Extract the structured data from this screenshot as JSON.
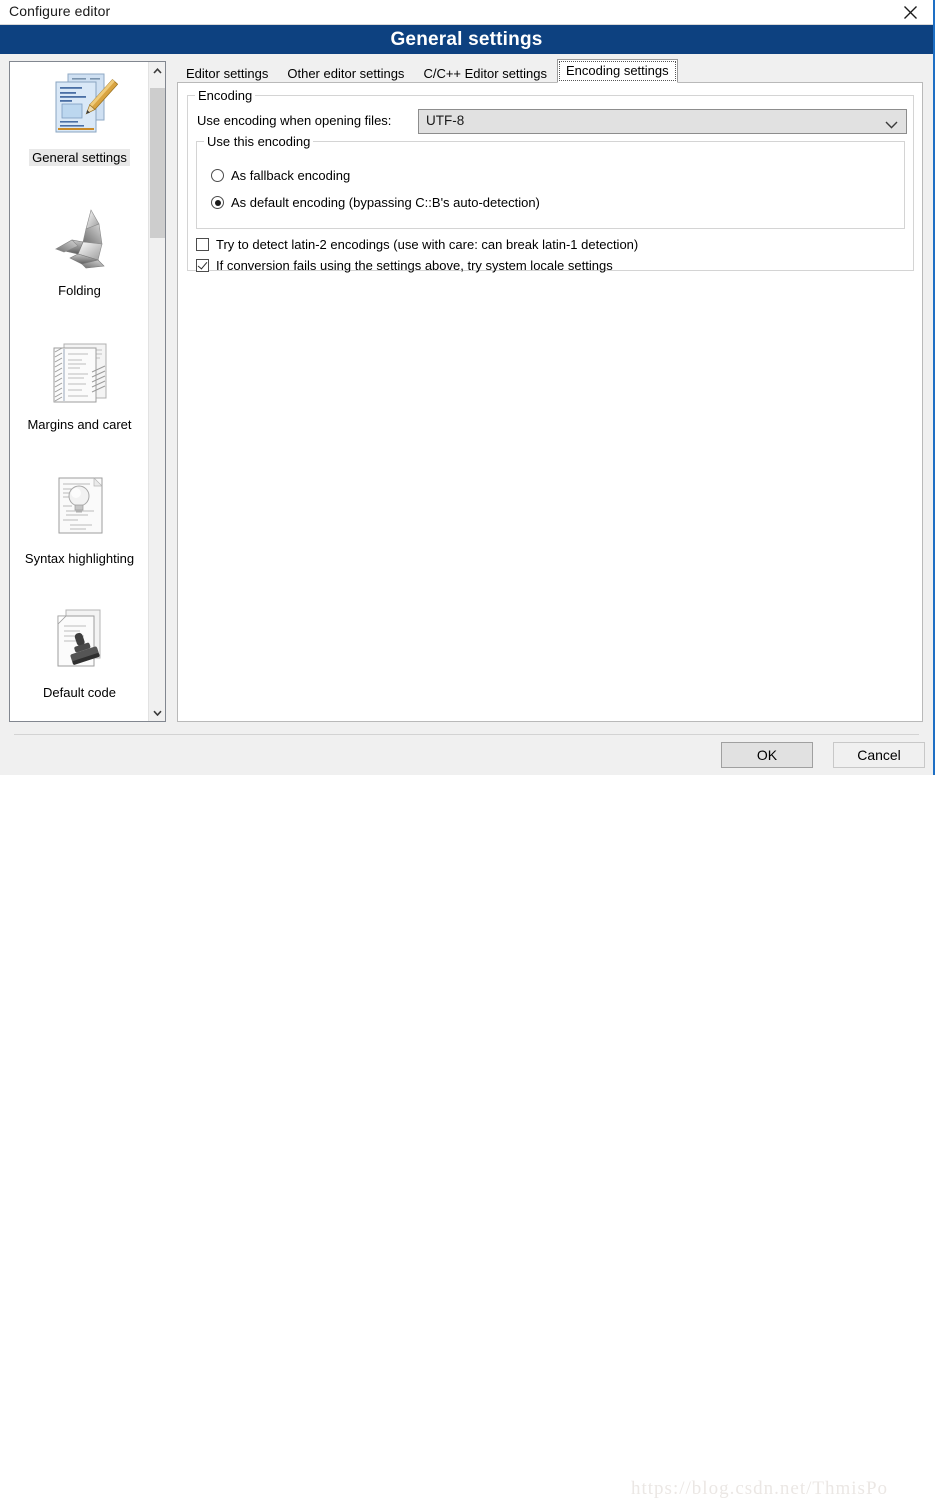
{
  "window": {
    "title": "Configure editor",
    "close_icon": "close-icon",
    "header_title": "General settings",
    "accent_blue": "#0d4180",
    "border_blue": "#1e6fc4"
  },
  "sidebar": {
    "items": [
      {
        "label": "General settings",
        "icon": "code-document-pencil-icon",
        "selected": true
      },
      {
        "label": "Folding",
        "icon": "origami-paper-crane-icon",
        "selected": false
      },
      {
        "label": "Margins and caret",
        "icon": "lined-document-stack-icon",
        "selected": false
      },
      {
        "label": "Syntax highlighting",
        "icon": "document-lightbulb-icon",
        "selected": false
      },
      {
        "label": "Default code",
        "icon": "document-rubber-stamp-icon",
        "selected": false
      }
    ],
    "scroll": {
      "up_icon": "chevron-up-icon",
      "down_icon": "chevron-down-icon"
    }
  },
  "tabs": [
    {
      "label": "Editor settings",
      "active": false
    },
    {
      "label": "Other editor settings",
      "active": false
    },
    {
      "label": "C/C++ Editor settings",
      "active": false
    },
    {
      "label": "Encoding settings",
      "active": true
    }
  ],
  "encoding_group": {
    "title": "Encoding",
    "use_encoding_label": "Use encoding when opening files:",
    "combo": {
      "value": "UTF-8",
      "arrow_icon": "chevron-down-icon"
    },
    "use_this_encoding": {
      "title": "Use this encoding",
      "options": [
        {
          "label": "As fallback encoding",
          "selected": false
        },
        {
          "label": "As default encoding (bypassing C::B's auto-detection)",
          "selected": true
        }
      ]
    },
    "checkboxes": [
      {
        "label": "Try to detect latin-2 encodings (use with care: can break latin-1 detection)",
        "checked": false
      },
      {
        "label": "If conversion fails using the settings above, try system locale settings",
        "checked": true
      }
    ]
  },
  "footer": {
    "ok_label": "OK",
    "cancel_label": "Cancel",
    "watermark": "https://blog.csdn.net/ThmisPo"
  }
}
